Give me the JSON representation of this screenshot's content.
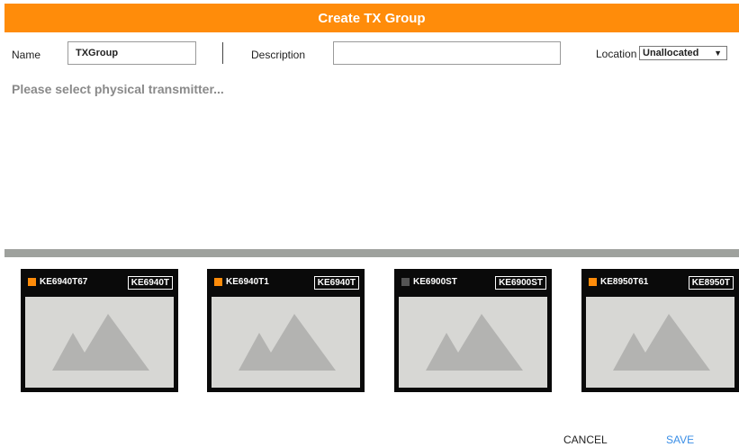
{
  "dialog": {
    "title": "Create TX Group"
  },
  "form": {
    "name_label": "Name",
    "name_value": "TXGroup",
    "description_label": "Description",
    "description_value": "",
    "location_label": "Location",
    "location_selected": "Unallocated"
  },
  "hint": "Please select physical transmitter...",
  "cards": [
    {
      "name": "KE6940T67",
      "tag": "KE6940T",
      "status_color": "#ff8c0a"
    },
    {
      "name": "KE6940T1",
      "tag": "KE6940T",
      "status_color": "#ff8c0a"
    },
    {
      "name": "KE6900ST",
      "tag": "KE6900ST",
      "status_color": "#555555"
    },
    {
      "name": "KE8950T61",
      "tag": "KE8950T",
      "status_color": "#ff8c0a"
    }
  ],
  "footer": {
    "cancel_label": "CANCEL",
    "save_label": "SAVE"
  },
  "icons": {
    "thumbnail": "image-placeholder-icon",
    "dropdown": "chevron-down-icon"
  }
}
